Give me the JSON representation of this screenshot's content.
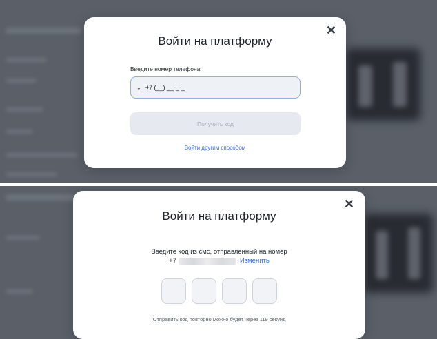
{
  "colors": {
    "accent": "#3c6fd1",
    "backdrop": "#5a5f68",
    "button_disabled_bg": "#e6e9ef",
    "button_disabled_text": "#a9b0bb"
  },
  "phone_step": {
    "title": "Войти на платформу",
    "close_icon": "close-icon",
    "phone_label": "Введите номер телефона",
    "country_chevron_icon": "chevron-down-icon",
    "phone_value": "+7 (__) __-_-_",
    "get_code_label": "Получить код",
    "other_method_label": "Войти другим способом"
  },
  "code_step": {
    "title": "Войти на платформу",
    "close_icon": "close-icon",
    "sms_text": "Введите код из смс, отправленный на номер",
    "phone_prefix": "+7",
    "change_label": "Изменить",
    "code_digits": [
      "",
      "",
      "",
      ""
    ],
    "resend_note": "Отправить код повторно можно будет через 119 секунд"
  }
}
